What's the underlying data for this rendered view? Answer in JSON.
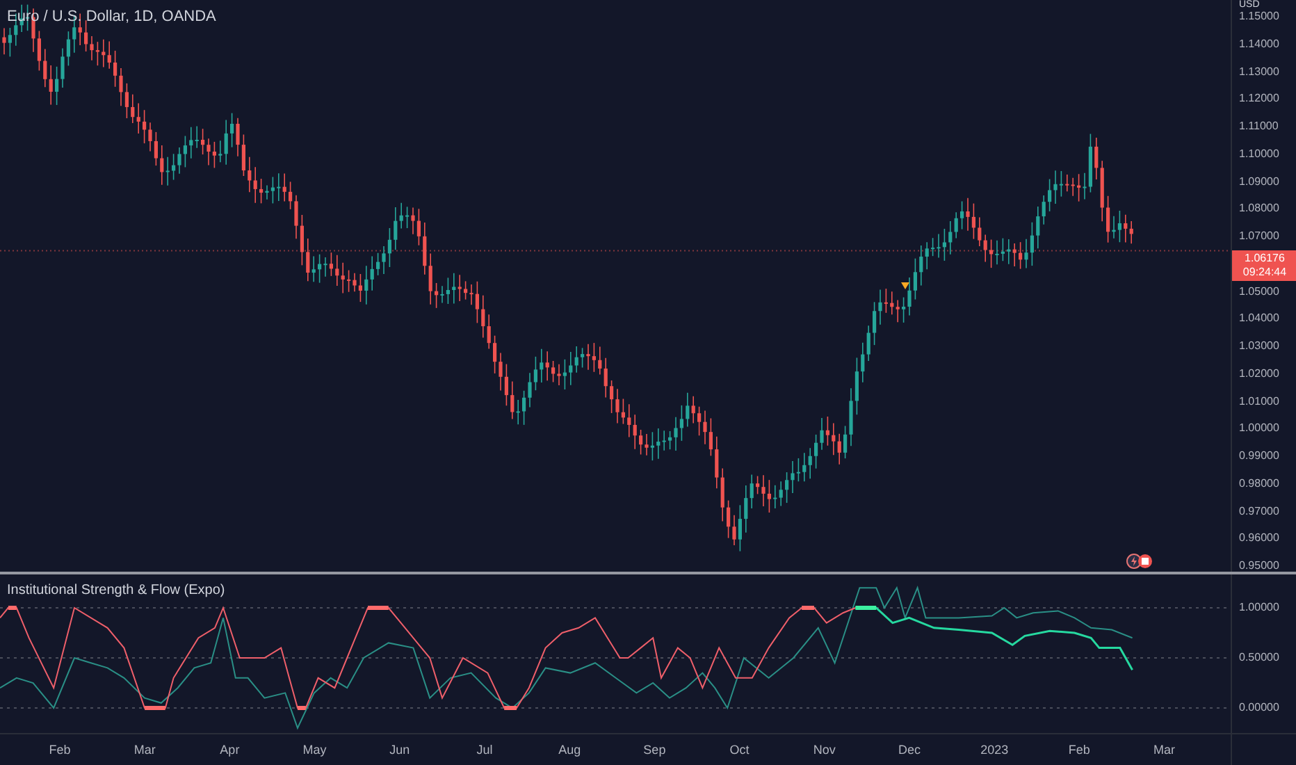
{
  "chart": {
    "title": "Euro / U.S. Dollar, 1D, OANDA",
    "currency": "USD",
    "price_axis_above": [
      "1.15000",
      "1.14000",
      "1.13000",
      "1.12000",
      "1.11000",
      "1.10000",
      "1.09000",
      "1.08000",
      "1.07000"
    ],
    "last_price": {
      "price": "1.06176",
      "countdown": "09:24:44"
    },
    "price_axis_below": [
      "1.05000",
      "1.04000",
      "1.03000",
      "1.02000",
      "1.01000",
      "1.00000",
      "0.99000",
      "0.98000",
      "0.97000",
      "0.96000",
      "0.95000"
    ]
  },
  "indicator": {
    "title": "Institutional Strength & Flow (Expo)",
    "axis": [
      "1.00000",
      "0.50000",
      "0.00000"
    ]
  },
  "time_axis": [
    "Feb",
    "Mar",
    "Apr",
    "May",
    "Jun",
    "Jul",
    "Aug",
    "Sep",
    "Oct",
    "Nov",
    "Dec",
    "2023",
    "Feb",
    "Mar"
  ]
}
